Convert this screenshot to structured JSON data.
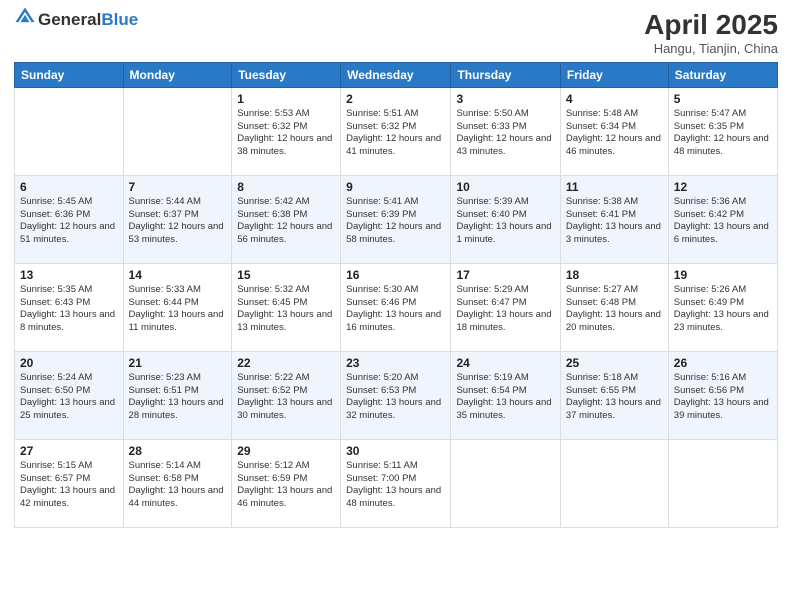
{
  "header": {
    "logo_general": "General",
    "logo_blue": "Blue",
    "month_title": "April 2025",
    "location": "Hangu, Tianjin, China"
  },
  "weekdays": [
    "Sunday",
    "Monday",
    "Tuesday",
    "Wednesday",
    "Thursday",
    "Friday",
    "Saturday"
  ],
  "weeks": [
    [
      {
        "day": "",
        "info": ""
      },
      {
        "day": "",
        "info": ""
      },
      {
        "day": "1",
        "info": "Sunrise: 5:53 AM\nSunset: 6:32 PM\nDaylight: 12 hours and 38 minutes."
      },
      {
        "day": "2",
        "info": "Sunrise: 5:51 AM\nSunset: 6:32 PM\nDaylight: 12 hours and 41 minutes."
      },
      {
        "day": "3",
        "info": "Sunrise: 5:50 AM\nSunset: 6:33 PM\nDaylight: 12 hours and 43 minutes."
      },
      {
        "day": "4",
        "info": "Sunrise: 5:48 AM\nSunset: 6:34 PM\nDaylight: 12 hours and 46 minutes."
      },
      {
        "day": "5",
        "info": "Sunrise: 5:47 AM\nSunset: 6:35 PM\nDaylight: 12 hours and 48 minutes."
      }
    ],
    [
      {
        "day": "6",
        "info": "Sunrise: 5:45 AM\nSunset: 6:36 PM\nDaylight: 12 hours and 51 minutes."
      },
      {
        "day": "7",
        "info": "Sunrise: 5:44 AM\nSunset: 6:37 PM\nDaylight: 12 hours and 53 minutes."
      },
      {
        "day": "8",
        "info": "Sunrise: 5:42 AM\nSunset: 6:38 PM\nDaylight: 12 hours and 56 minutes."
      },
      {
        "day": "9",
        "info": "Sunrise: 5:41 AM\nSunset: 6:39 PM\nDaylight: 12 hours and 58 minutes."
      },
      {
        "day": "10",
        "info": "Sunrise: 5:39 AM\nSunset: 6:40 PM\nDaylight: 13 hours and 1 minute."
      },
      {
        "day": "11",
        "info": "Sunrise: 5:38 AM\nSunset: 6:41 PM\nDaylight: 13 hours and 3 minutes."
      },
      {
        "day": "12",
        "info": "Sunrise: 5:36 AM\nSunset: 6:42 PM\nDaylight: 13 hours and 6 minutes."
      }
    ],
    [
      {
        "day": "13",
        "info": "Sunrise: 5:35 AM\nSunset: 6:43 PM\nDaylight: 13 hours and 8 minutes."
      },
      {
        "day": "14",
        "info": "Sunrise: 5:33 AM\nSunset: 6:44 PM\nDaylight: 13 hours and 11 minutes."
      },
      {
        "day": "15",
        "info": "Sunrise: 5:32 AM\nSunset: 6:45 PM\nDaylight: 13 hours and 13 minutes."
      },
      {
        "day": "16",
        "info": "Sunrise: 5:30 AM\nSunset: 6:46 PM\nDaylight: 13 hours and 16 minutes."
      },
      {
        "day": "17",
        "info": "Sunrise: 5:29 AM\nSunset: 6:47 PM\nDaylight: 13 hours and 18 minutes."
      },
      {
        "day": "18",
        "info": "Sunrise: 5:27 AM\nSunset: 6:48 PM\nDaylight: 13 hours and 20 minutes."
      },
      {
        "day": "19",
        "info": "Sunrise: 5:26 AM\nSunset: 6:49 PM\nDaylight: 13 hours and 23 minutes."
      }
    ],
    [
      {
        "day": "20",
        "info": "Sunrise: 5:24 AM\nSunset: 6:50 PM\nDaylight: 13 hours and 25 minutes."
      },
      {
        "day": "21",
        "info": "Sunrise: 5:23 AM\nSunset: 6:51 PM\nDaylight: 13 hours and 28 minutes."
      },
      {
        "day": "22",
        "info": "Sunrise: 5:22 AM\nSunset: 6:52 PM\nDaylight: 13 hours and 30 minutes."
      },
      {
        "day": "23",
        "info": "Sunrise: 5:20 AM\nSunset: 6:53 PM\nDaylight: 13 hours and 32 minutes."
      },
      {
        "day": "24",
        "info": "Sunrise: 5:19 AM\nSunset: 6:54 PM\nDaylight: 13 hours and 35 minutes."
      },
      {
        "day": "25",
        "info": "Sunrise: 5:18 AM\nSunset: 6:55 PM\nDaylight: 13 hours and 37 minutes."
      },
      {
        "day": "26",
        "info": "Sunrise: 5:16 AM\nSunset: 6:56 PM\nDaylight: 13 hours and 39 minutes."
      }
    ],
    [
      {
        "day": "27",
        "info": "Sunrise: 5:15 AM\nSunset: 6:57 PM\nDaylight: 13 hours and 42 minutes."
      },
      {
        "day": "28",
        "info": "Sunrise: 5:14 AM\nSunset: 6:58 PM\nDaylight: 13 hours and 44 minutes."
      },
      {
        "day": "29",
        "info": "Sunrise: 5:12 AM\nSunset: 6:59 PM\nDaylight: 13 hours and 46 minutes."
      },
      {
        "day": "30",
        "info": "Sunrise: 5:11 AM\nSunset: 7:00 PM\nDaylight: 13 hours and 48 minutes."
      },
      {
        "day": "",
        "info": ""
      },
      {
        "day": "",
        "info": ""
      },
      {
        "day": "",
        "info": ""
      }
    ]
  ]
}
